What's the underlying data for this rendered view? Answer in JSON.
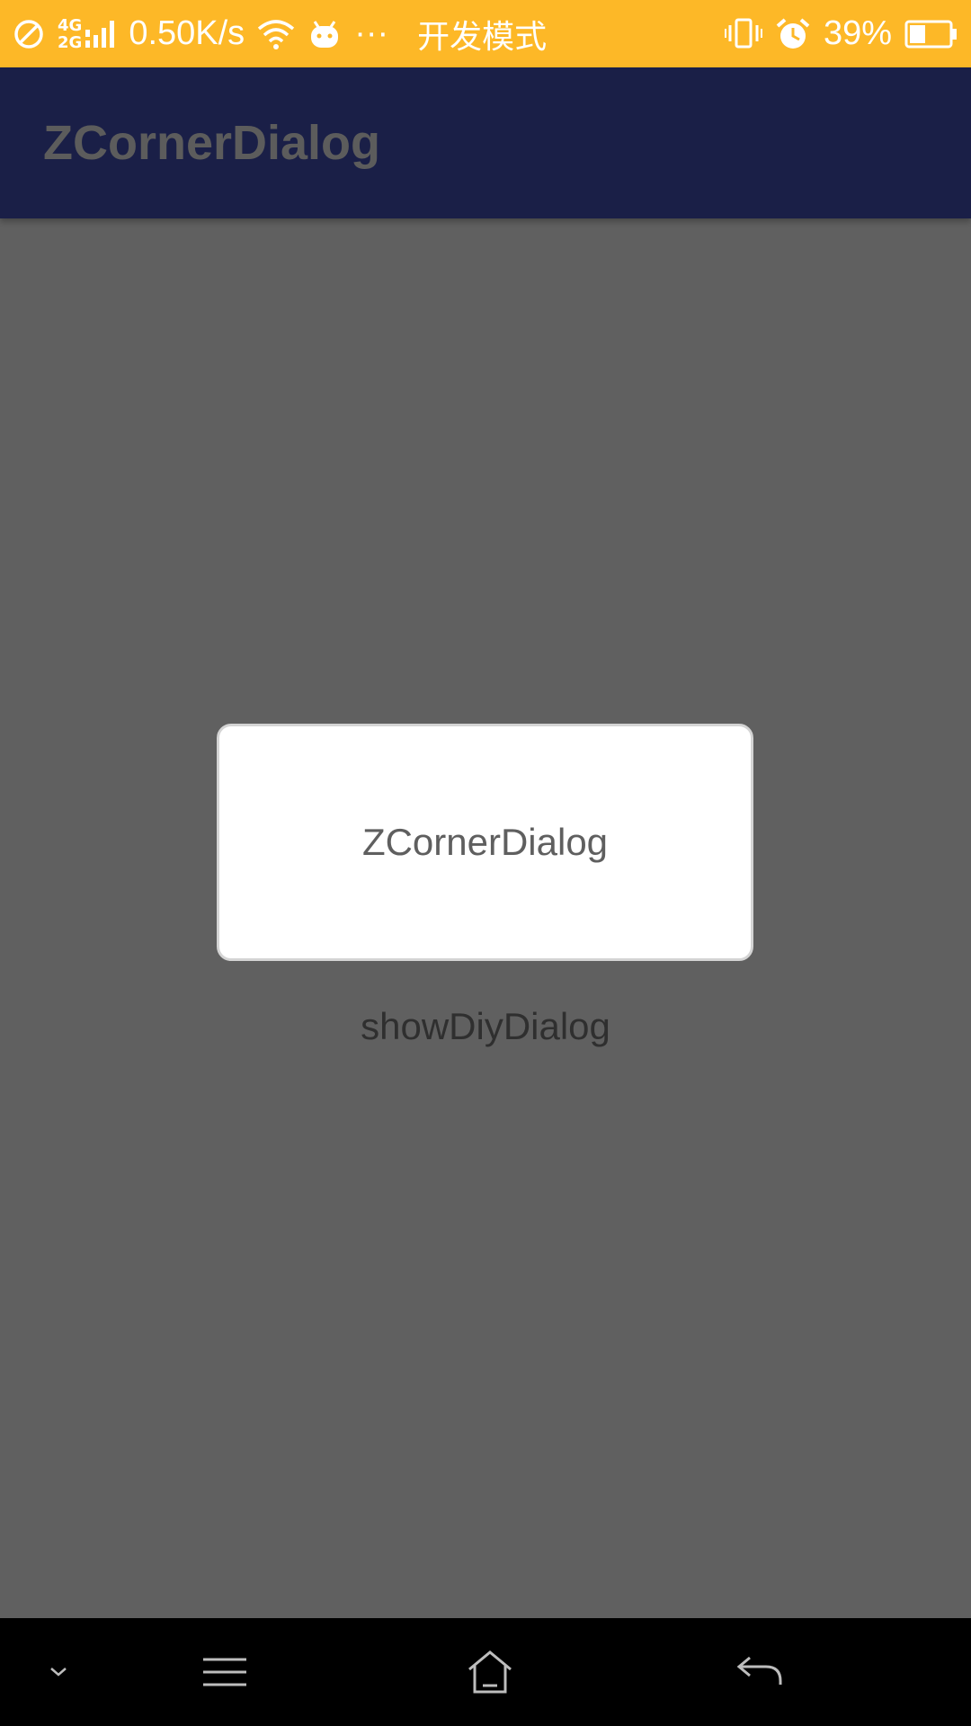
{
  "status_bar": {
    "network_top": "4G",
    "network_bottom": "2G",
    "speed": "0.50K/s",
    "more": "···",
    "mode": "开发模式",
    "battery": "39%",
    "icons": [
      "no-disturb-icon",
      "signal-icon",
      "wifi-icon",
      "android-icon",
      "vibrate-icon",
      "alarm-icon",
      "battery-icon"
    ]
  },
  "app_bar": {
    "title": "ZCornerDialog"
  },
  "dialog": {
    "message": "ZCornerDialog"
  },
  "main": {
    "button_label": "showDiyDialog"
  },
  "nav_bar": {
    "icons": [
      "chevron-down-icon",
      "menu-icon",
      "home-icon",
      "back-icon"
    ]
  },
  "colors": {
    "status_bar": "#FDB827",
    "app_bar": "#1A1F47",
    "scrim_background": "#606060",
    "dialog": "#FFFFFF",
    "nav_bar": "#000000"
  }
}
